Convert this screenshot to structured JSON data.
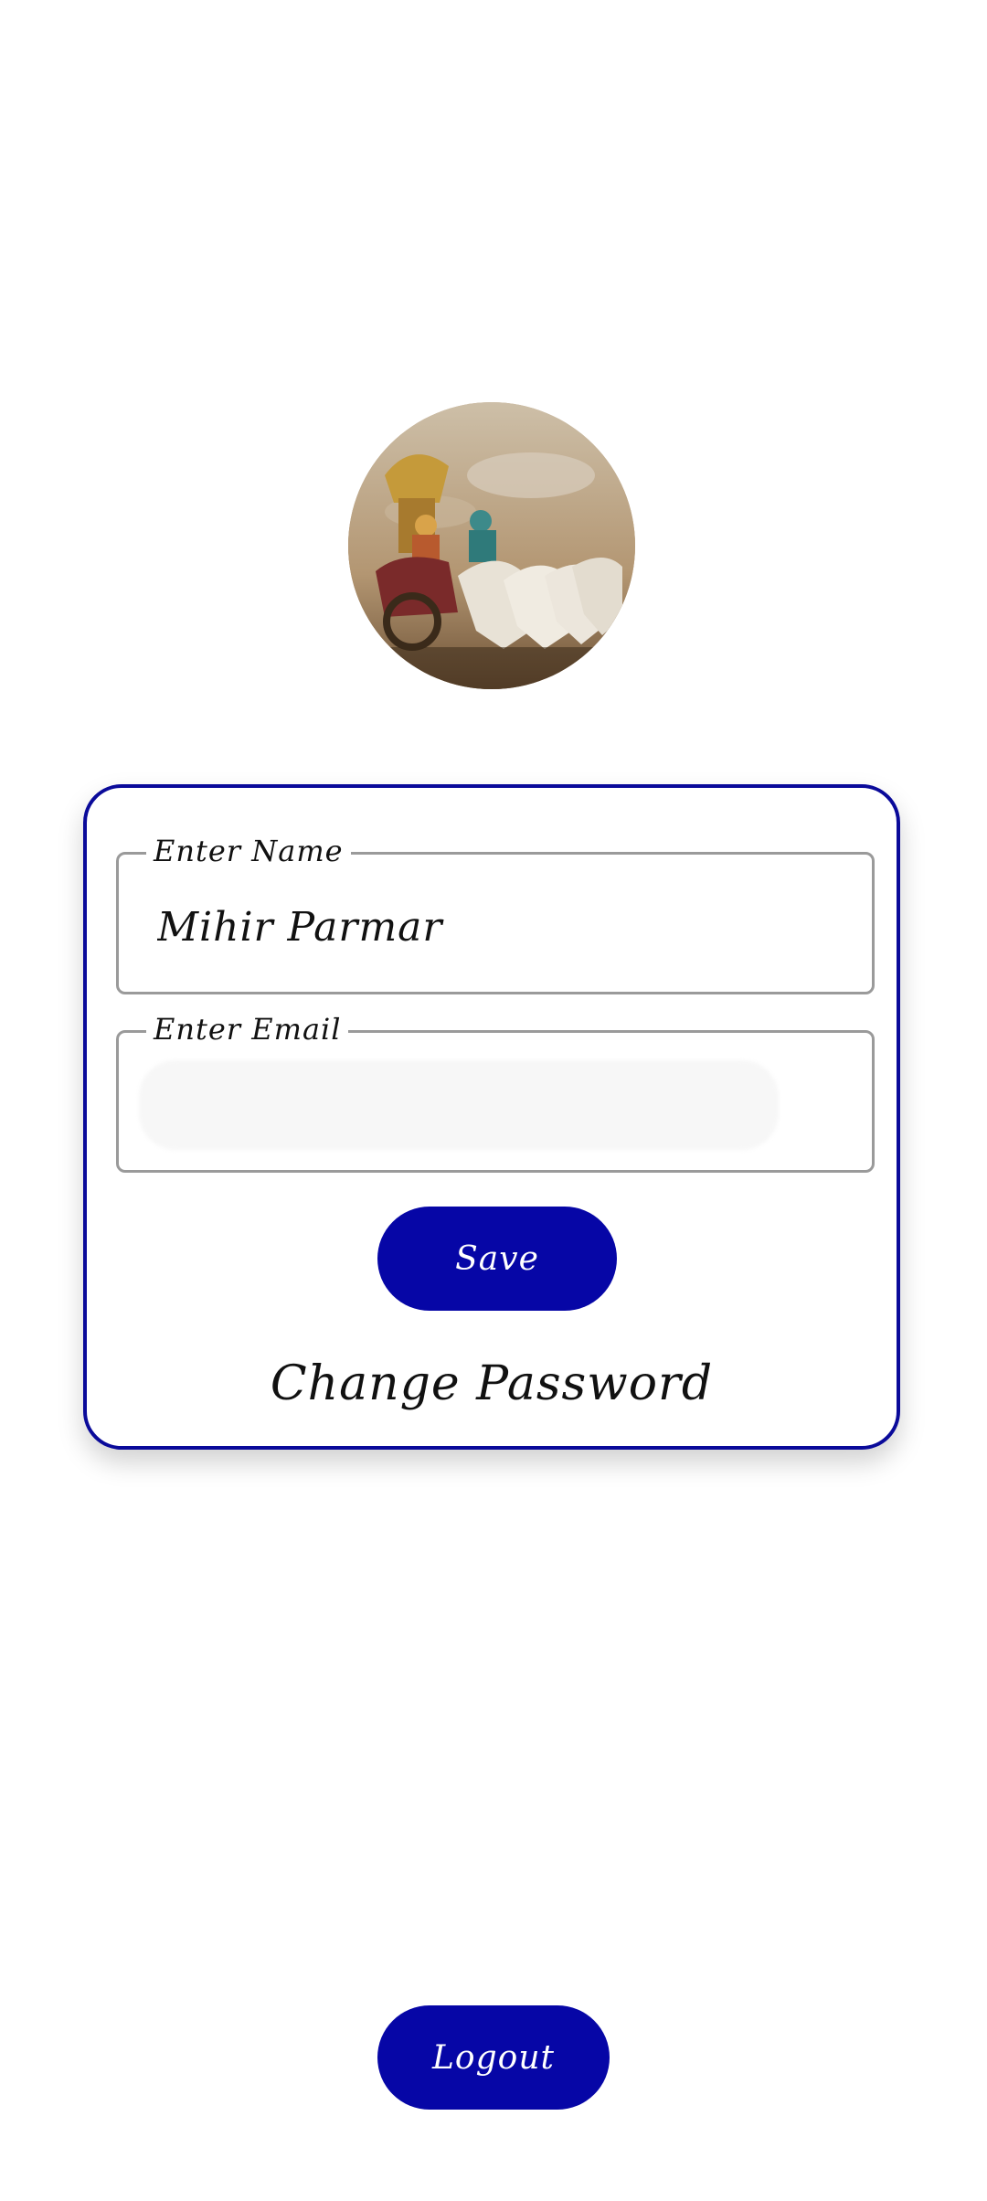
{
  "profile": {
    "avatar_icon": "avatar-image"
  },
  "form": {
    "name_label": "Enter Name",
    "name_value": "Mihir Parmar",
    "email_label": "Enter Email",
    "email_value": "",
    "save_label": "Save",
    "change_password_label": "Change Password"
  },
  "footer": {
    "logout_label": "Logout"
  },
  "colors": {
    "accent": "#0606a6",
    "card_border": "#0a0a9a",
    "field_border": "#9a9a9a",
    "background": "#ffffff"
  }
}
